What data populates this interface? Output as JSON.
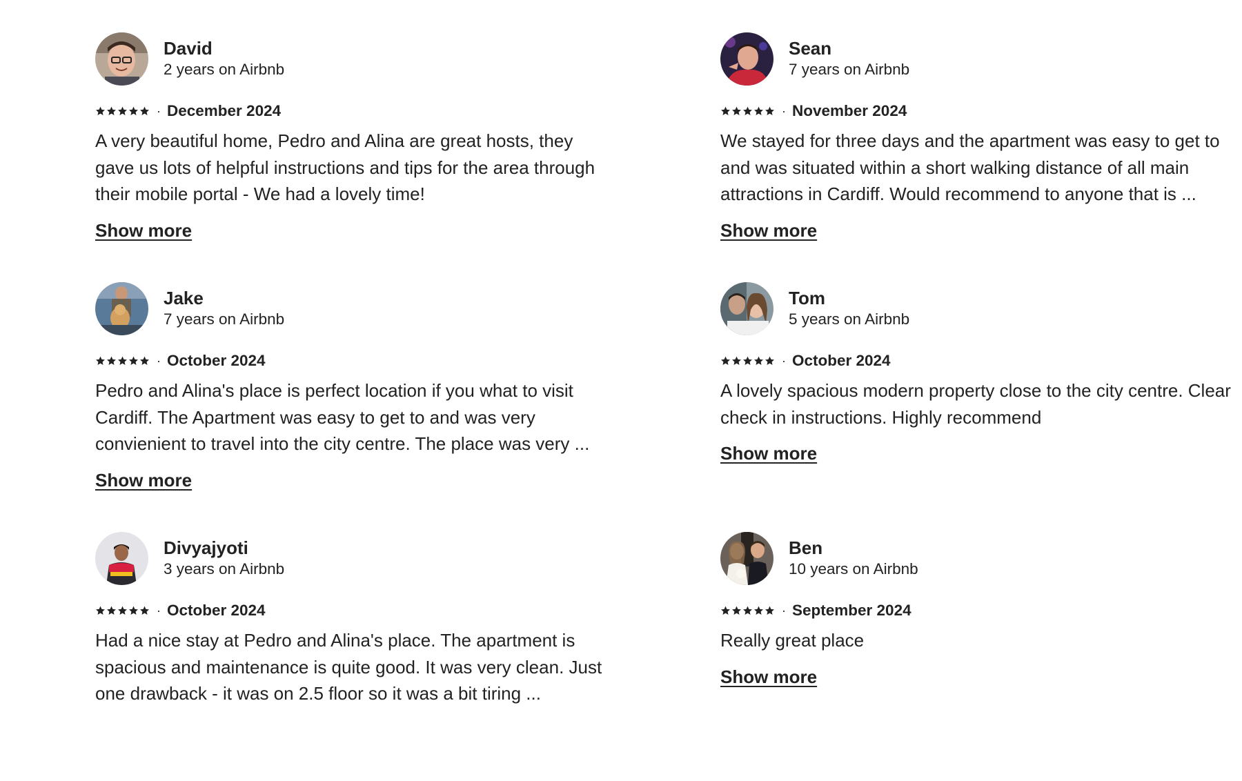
{
  "reviews": [
    {
      "name": "David",
      "tenure": "2 years on Airbnb",
      "rating": 5,
      "date": "December 2024",
      "text": "A very beautiful home, Pedro and Alina are great hosts, they gave us lots of helpful instructions and tips for the area through their mobile portal - We had a lovely time!",
      "show_more": "Show more"
    },
    {
      "name": "Sean",
      "tenure": "7 years on Airbnb",
      "rating": 5,
      "date": "November 2024",
      "text": "We stayed for three days and the apartment was easy to get to and was situated within a short walking distance of all main attractions in Cardiff. Would recommend to anyone that is ...",
      "show_more": "Show more"
    },
    {
      "name": "Jake",
      "tenure": "7 years on Airbnb",
      "rating": 5,
      "date": "October 2024",
      "text": "Pedro and Alina's place is perfect location if you what to visit Cardiff. The Apartment was easy to get to and was very convienient to travel into the city centre. The place was very ...",
      "show_more": "Show more"
    },
    {
      "name": "Tom",
      "tenure": "5 years on Airbnb",
      "rating": 5,
      "date": "October 2024",
      "text": "A lovely spacious modern property close to the city centre. Clear check in instructions. Highly recommend",
      "show_more": "Show more"
    },
    {
      "name": "Divyajyoti",
      "tenure": "3 years on Airbnb",
      "rating": 5,
      "date": "October 2024",
      "text": "Had a nice stay at Pedro and Alina's place. The apartment is spacious and maintenance is quite good. It was very clean. Just one drawback - it was on 2.5 floor so it was a bit tiring ...",
      "show_more": ""
    },
    {
      "name": "Ben",
      "tenure": "10 years on Airbnb",
      "rating": 5,
      "date": "September 2024",
      "text": "Really great place",
      "show_more": "Show more"
    }
  ],
  "icons": {
    "star": "star-icon",
    "avatar": "avatar-photo"
  },
  "colors": {
    "text": "#222222",
    "star": "#222222",
    "background": "#ffffff"
  }
}
